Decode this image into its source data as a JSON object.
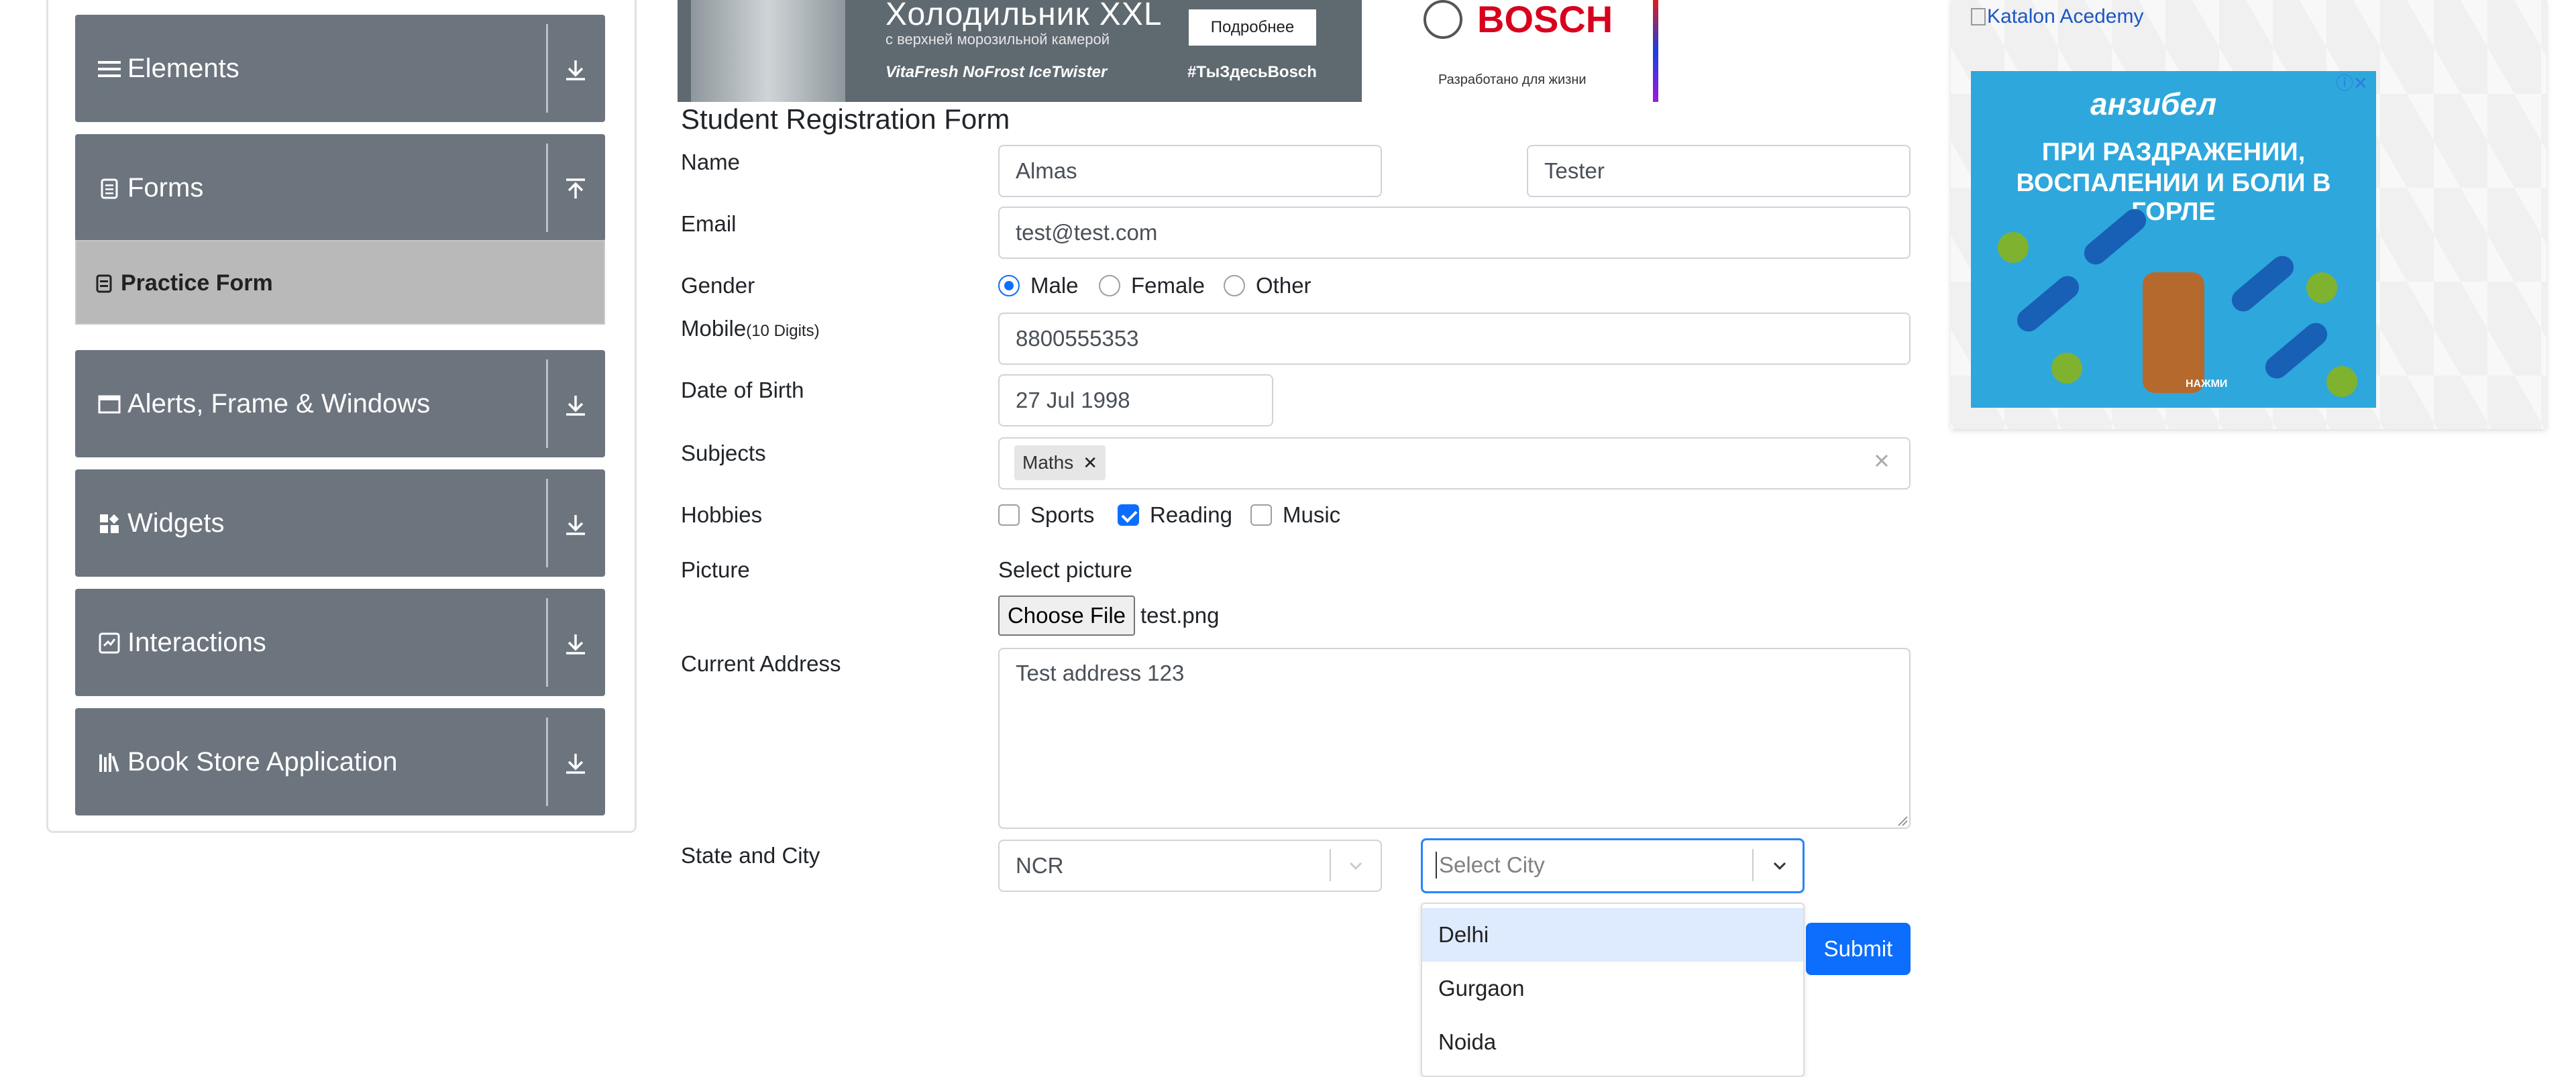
{
  "sidebar": {
    "groups": [
      {
        "label": "Elements",
        "icon": "list-icon",
        "arrow": "download-arrow-icon"
      },
      {
        "label": "Forms",
        "icon": "clipboard-icon",
        "arrow": "upload-arrow-icon"
      },
      {
        "label": "Alerts, Frame & Windows",
        "icon": "window-icon",
        "arrow": "download-arrow-icon"
      },
      {
        "label": "Widgets",
        "icon": "widgets-icon",
        "arrow": "download-arrow-icon"
      },
      {
        "label": "Interactions",
        "icon": "interactions-icon",
        "arrow": "download-arrow-icon"
      },
      {
        "label": "Book Store Application",
        "icon": "books-icon",
        "arrow": "download-arrow-icon"
      }
    ],
    "active_item": {
      "label": "Practice Form",
      "icon": "form-icon"
    }
  },
  "top_ad": {
    "title": "Холодильник XXL",
    "subtitle": "с верхней морозильной камерой",
    "features": "VitaFresh  NoFrost  IceTwister",
    "button": "Подробнее",
    "hashtag": "#ТыЗдесьBosch",
    "brand": "BOSCH",
    "slogan": "Разработано для жизни"
  },
  "form": {
    "title": "Student Registration Form",
    "labels": {
      "name": "Name",
      "email": "Email",
      "gender": "Gender",
      "mobile": "Mobile",
      "mobile_hint": "(10 Digits)",
      "dob": "Date of Birth",
      "subjects": "Subjects",
      "hobbies": "Hobbies",
      "picture": "Picture",
      "address": "Current Address",
      "state_city": "State and City"
    },
    "first_name": "Almas",
    "last_name": "Tester",
    "email": "test@test.com",
    "gender_options": [
      "Male",
      "Female",
      "Other"
    ],
    "gender_selected": "Male",
    "mobile": "8800555353",
    "dob": "27 Jul 1998",
    "subjects": [
      "Maths"
    ],
    "hobbies": [
      {
        "label": "Sports",
        "checked": false
      },
      {
        "label": "Reading",
        "checked": true
      },
      {
        "label": "Music",
        "checked": false
      }
    ],
    "picture_label": "Select picture",
    "file_button": "Choose File",
    "file_name": "test.png",
    "address": "Test address 123",
    "state": "NCR",
    "city_placeholder": "Select City",
    "city_options": [
      "Delhi",
      "Gurgaon",
      "Noida"
    ],
    "city_highlighted": "Delhi",
    "submit": "Submit"
  },
  "right_ad": {
    "link_text": "Katalon Acedemy",
    "brand": "анзибел",
    "line1": "ПРИ РАЗДРАЖЕНИИ,",
    "line2": "ВОСПАЛЕНИИ И БОЛИ В ГОРЛЕ",
    "press": "НАЖМИ"
  },
  "colors": {
    "sidebar_group": "#6c757d",
    "active_item": "#b9b9b9",
    "primary": "#0d6efd",
    "focus_border": "#2684ff",
    "menu_highlight": "#deebff"
  }
}
